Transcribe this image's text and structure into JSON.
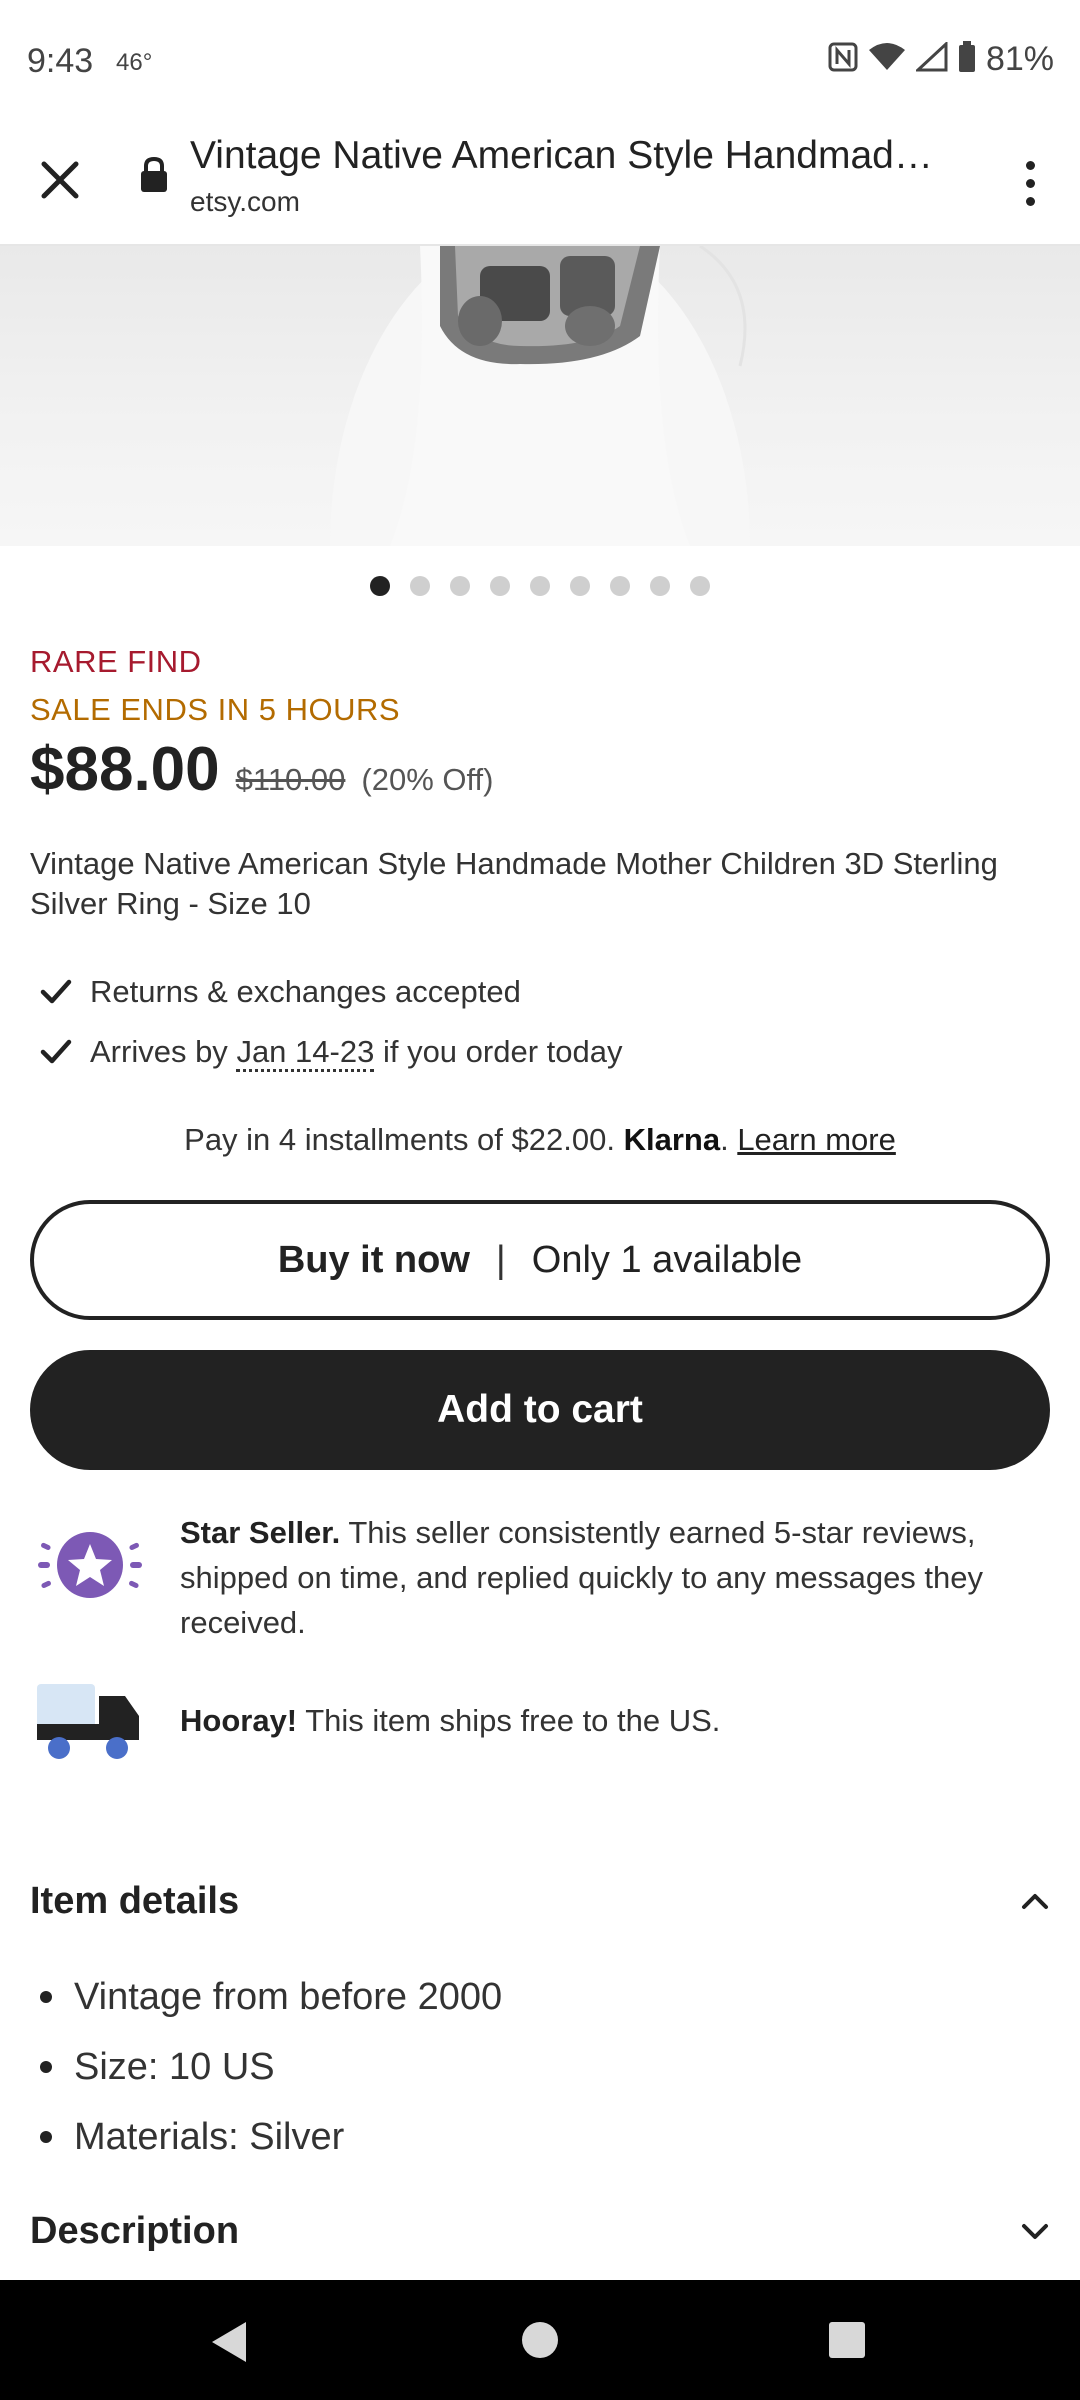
{
  "status_bar": {
    "time": "9:43",
    "temperature": "46°",
    "battery": "81%"
  },
  "browser": {
    "page_title": "Vintage Native American Style Handmade Mother Children 3D Sterling Silver Ring - Size 10",
    "domain": "etsy.com"
  },
  "gallery": {
    "image_count": 9,
    "active_index": 0
  },
  "listing": {
    "badge": "RARE FIND",
    "sale_notice": "SALE ENDS IN 5 HOURS",
    "price": "$88.00",
    "original_price": "$110.00",
    "discount": "(20% Off)",
    "title": "Vintage Native American Style Handmade Mother Children 3D Sterling Silver Ring - Size 10"
  },
  "features": {
    "returns": "Returns & exchanges accepted",
    "arrives_prefix": "Arrives by",
    "arrives_date": "Jan 14-23",
    "arrives_suffix": "if you order today"
  },
  "klarna": {
    "text": "Pay in 4 installments of $22.00.",
    "brand": "Klarna",
    "period": ".",
    "link": "Learn more"
  },
  "buttons": {
    "buy_now": "Buy it now",
    "separator": "|",
    "availability": "Only 1 available",
    "add_to_cart": "Add to cart"
  },
  "star_seller": {
    "label": "Star Seller.",
    "text": "This seller consistently earned 5-star reviews, shipped on time, and replied quickly to any messages they received."
  },
  "shipping": {
    "label": "Hooray!",
    "text": "This item ships free to the US."
  },
  "item_details": {
    "title": "Item details",
    "items": [
      "Vintage from before 2000",
      "Size: 10 US",
      "Materials: Silver"
    ]
  },
  "description": {
    "title": "Description"
  },
  "colors": {
    "rare_find": "#a61a2e",
    "sale": "#b36b00",
    "star_seller_purple": "#7d59b5",
    "primary_dark": "#222222"
  }
}
